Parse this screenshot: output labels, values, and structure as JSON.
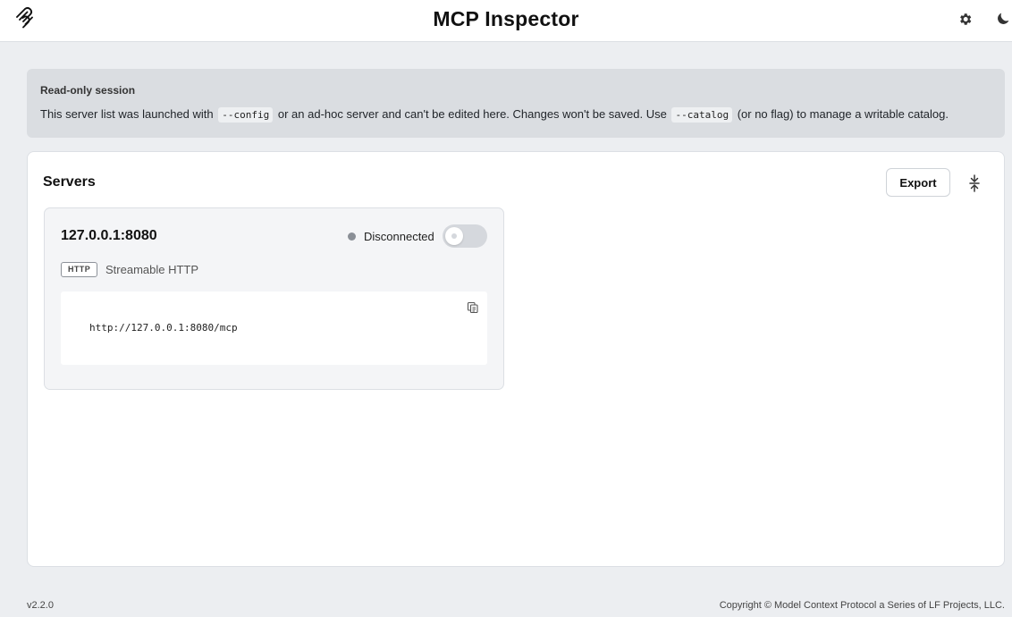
{
  "app": {
    "title": "MCP Inspector",
    "logo_icon": "mcp-logo-icon",
    "settings_icon": "gear-icon",
    "theme_icon": "moon-icon"
  },
  "notice": {
    "title": "Read-only session",
    "text_part1": "This server list was launched with",
    "code1": "--config",
    "text_part2": "or an ad-hoc server and can't be edited here. Changes won't be saved. Use",
    "code2": "--catalog",
    "text_part3": "(or no flag) to manage a writable catalog."
  },
  "servers": {
    "title": "Servers",
    "export_label": "Export",
    "collapse_icon": "collapse-vertical-icon",
    "items": [
      {
        "name": "127.0.0.1:8080",
        "status": "Disconnected",
        "status_color": "#8a8f96",
        "connected": false,
        "transport_badge": "HTTP",
        "transport_label": "Streamable HTTP",
        "url": "http://127.0.0.1:8080/mcp",
        "copy_icon": "copy-icon"
      }
    ]
  },
  "footer": {
    "version": "v2.2.0",
    "copyright": "Copyright © Model Context Protocol a Series of LF Projects, LLC."
  }
}
